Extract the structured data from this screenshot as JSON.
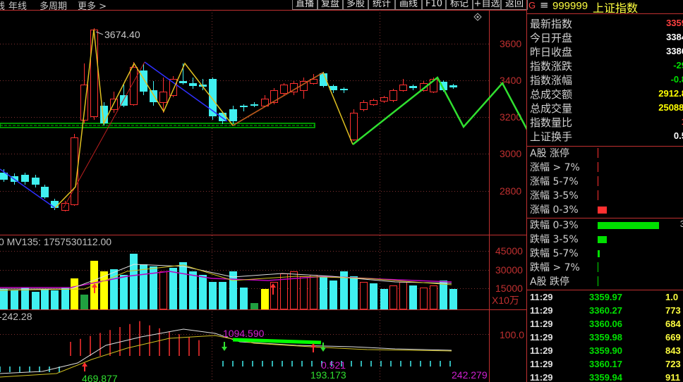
{
  "toolbar": {
    "left_tabs": [
      "线",
      "年线",
      "多周期",
      "更多 >"
    ],
    "buttons": [
      "直播",
      "复盘",
      "多股",
      "统计",
      "画线",
      "F10",
      "标记",
      "+自选",
      "返回"
    ],
    "settings_icon": "diamond-settings-icon"
  },
  "chart": {
    "high_label": "3674.40",
    "y_ticks": [
      "3600",
      "3400",
      "3200",
      "3000",
      "2800"
    ],
    "y_tick_values": [
      3600,
      3400,
      3200,
      3000,
      2800
    ]
  },
  "volume": {
    "legend": "0  MV135: 1757530112.00",
    "y_ticks": [
      "45000",
      "30000",
      "15000"
    ],
    "unit": "X10万"
  },
  "indicator": {
    "legend": "-242.28",
    "y_tick": "100.0",
    "labels": [
      "1094.590",
      "469.877",
      "0.521",
      "193.173",
      "242.279"
    ]
  },
  "quote": {
    "code": "999999",
    "name": "上证指数",
    "g_label": "G",
    "menu_icon": "≡",
    "rows": [
      {
        "label": "最新指数",
        "value": "3359",
        "color": "#ff4040"
      },
      {
        "label": "今日开盘",
        "value": "3384",
        "color": "#ffffff"
      },
      {
        "label": "昨日收盘",
        "value": "3386",
        "color": "#ffffff"
      },
      {
        "label": "指数涨跌",
        "value": "-29",
        "color": "#00e000"
      },
      {
        "label": "指数涨幅",
        "value": "-0.8",
        "color": "#00e000"
      },
      {
        "label": "总成交额",
        "value": "2912.8",
        "color": "#ffff00"
      },
      {
        "label": "总成交量",
        "value": "25088.",
        "color": "#ffff00"
      },
      {
        "label": "指数量比",
        "value": "1",
        "color": "#ff4040"
      },
      {
        "label": "上证换手",
        "value": "0.5",
        "color": "#ffffff"
      }
    ],
    "up_dist": [
      {
        "label": "A股 涨停",
        "bar": 0.01,
        "count": ""
      },
      {
        "label": "涨幅 > 7%",
        "bar": 0.01,
        "count": ""
      },
      {
        "label": "涨幅 5-7%",
        "bar": 0.01,
        "count": ""
      },
      {
        "label": "涨幅 3-5%",
        "bar": 0.01,
        "count": ""
      },
      {
        "label": "涨幅 0-3%",
        "bar": 0.14,
        "count": ""
      }
    ],
    "down_dist": [
      {
        "label": "跌幅 0-3%",
        "bar": 0.95,
        "count": "3"
      },
      {
        "label": "跌幅 3-5%",
        "bar": 0.14,
        "count": ""
      },
      {
        "label": "跌幅 5-7%",
        "bar": 0.03,
        "count": ""
      },
      {
        "label": "跌幅 > 7%",
        "bar": 0.01,
        "count": ""
      },
      {
        "label": "A股 跌停",
        "bar": 0.01,
        "count": ""
      }
    ],
    "ticks": [
      {
        "time": "11:29",
        "price": "3359.97",
        "vol": "1.0"
      },
      {
        "time": "11:29",
        "price": "3360.27",
        "vol": "773"
      },
      {
        "time": "11:29",
        "price": "3360.06",
        "vol": "684"
      },
      {
        "time": "11:29",
        "price": "3359.98",
        "vol": "669"
      },
      {
        "time": "11:29",
        "price": "3359.90",
        "vol": "843"
      },
      {
        "time": "11:29",
        "price": "3360.17",
        "vol": "723"
      },
      {
        "time": "11:29",
        "price": "3359.94",
        "vol": "911"
      }
    ]
  },
  "colors": {
    "up": "#ff3030",
    "down": "#40f0f0",
    "frame": "#c03030",
    "green": "#00ff00",
    "yellow": "#ffff00"
  }
}
